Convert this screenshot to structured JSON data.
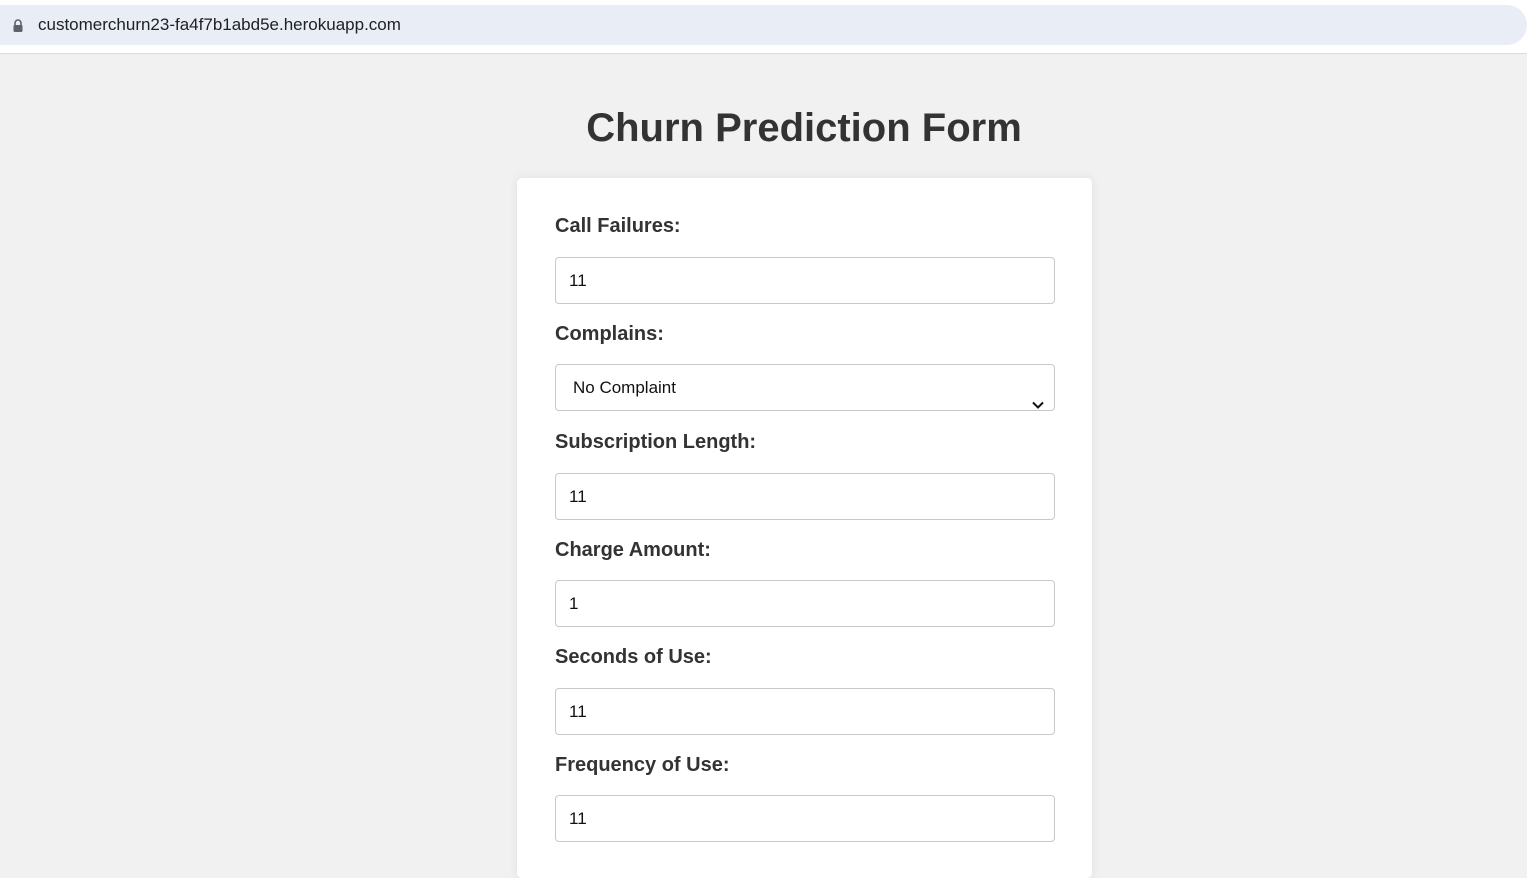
{
  "browser": {
    "url": "customerchurn23-fa4f7b1abd5e.herokuapp.com"
  },
  "page": {
    "title": "Churn Prediction Form"
  },
  "form": {
    "call_failures": {
      "label": "Call Failures:",
      "value": "11"
    },
    "complains": {
      "label": "Complains:",
      "selected": "No Complaint"
    },
    "subscription_length": {
      "label": "Subscription Length:",
      "value": "11"
    },
    "charge_amount": {
      "label": "Charge Amount:",
      "value": "1"
    },
    "seconds_of_use": {
      "label": "Seconds of Use:",
      "value": "11"
    },
    "frequency_of_use": {
      "label": "Frequency of Use:",
      "value": "11"
    }
  },
  "icons": {
    "lock": "lock-icon",
    "chevron": "chevron-down-icon"
  }
}
